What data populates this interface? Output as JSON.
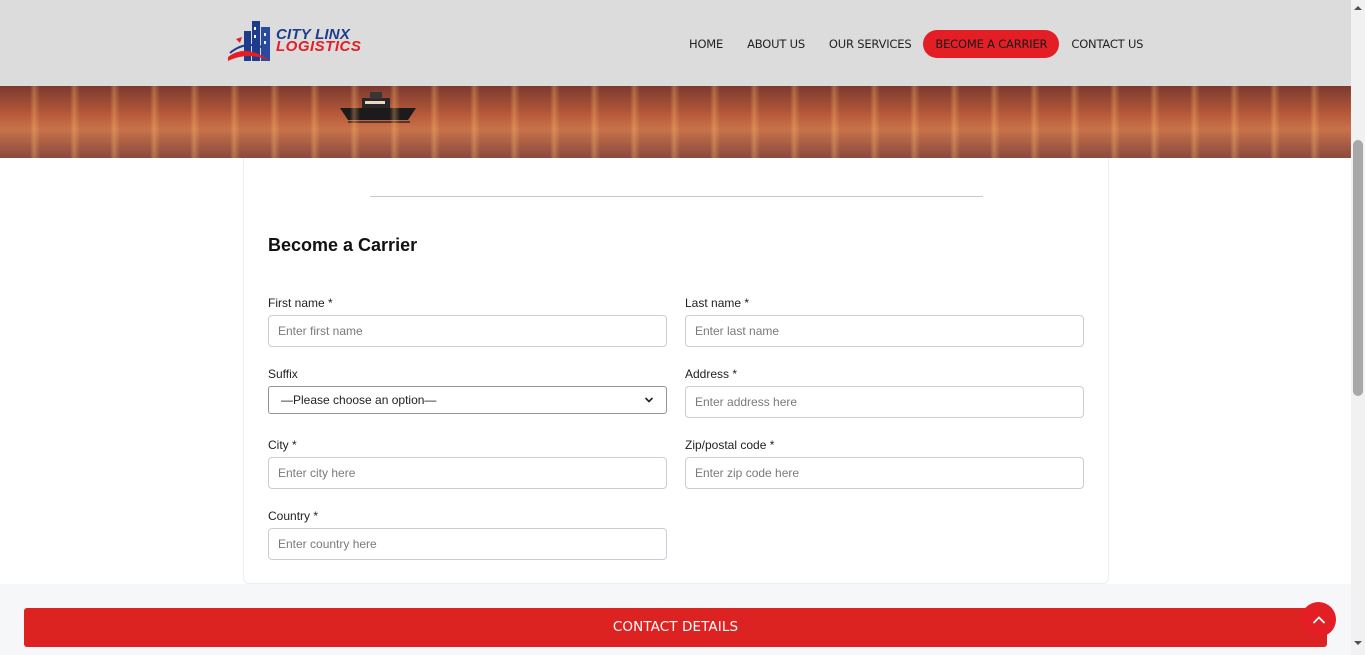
{
  "logo": {
    "line1": "CITY LINX",
    "line2": "LOGISTICS"
  },
  "nav": {
    "items": [
      {
        "label": "HOME"
      },
      {
        "label": "ABOUT US"
      },
      {
        "label": "OUR SERVICES"
      },
      {
        "label": "BECOME A CARRIER",
        "active": true
      },
      {
        "label": "CONTACT US"
      }
    ]
  },
  "form": {
    "title": "Become a Carrier",
    "first_name": {
      "label": "First name *",
      "placeholder": "Enter first name"
    },
    "last_name": {
      "label": "Last name *",
      "placeholder": "Enter last name"
    },
    "suffix": {
      "label": "Suffix",
      "selected": "—Please choose an option—"
    },
    "address": {
      "label": "Address *",
      "placeholder": "Enter address here"
    },
    "city": {
      "label": "City *",
      "placeholder": "Enter city here"
    },
    "zip": {
      "label": "Zip/postal code *",
      "placeholder": "Enter zip code here"
    },
    "country": {
      "label": "Country *",
      "placeholder": "Enter country here"
    }
  },
  "contact_details": {
    "label": "CONTACT DETAILS"
  },
  "icons": {
    "scroll_top": "chevron-up-icon",
    "select_arrow": "chevron-down-icon"
  },
  "colors": {
    "accent": "#e31e24",
    "contact_bar": "#dd2222",
    "header_bg": "#dcdcdc",
    "brand_blue": "#1f3c8c"
  }
}
